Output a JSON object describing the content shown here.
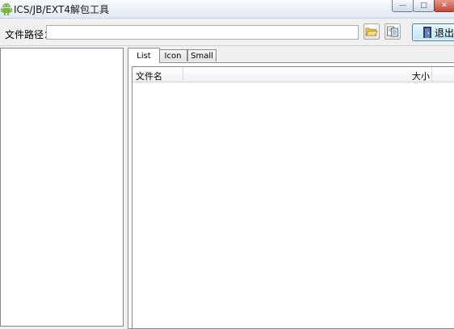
{
  "window": {
    "title": "ICS/JB/EXT4解包工具",
    "controls": {
      "minimize": "—",
      "maximize": "□",
      "close": "✕"
    }
  },
  "toolbar": {
    "path_label": "文件路径：",
    "path_value": "",
    "open_icon": "folder-open-icon",
    "extract_icon": "extract-icon",
    "exit_label": "退出"
  },
  "tabs": [
    {
      "label": "List",
      "active": true
    },
    {
      "label": "Icon",
      "active": false
    },
    {
      "label": "Small",
      "active": false
    }
  ],
  "list": {
    "columns": [
      "文件名",
      "大小"
    ],
    "rows": []
  },
  "colors": {
    "accent": "#3c7fb1",
    "close": "#c44b37"
  }
}
